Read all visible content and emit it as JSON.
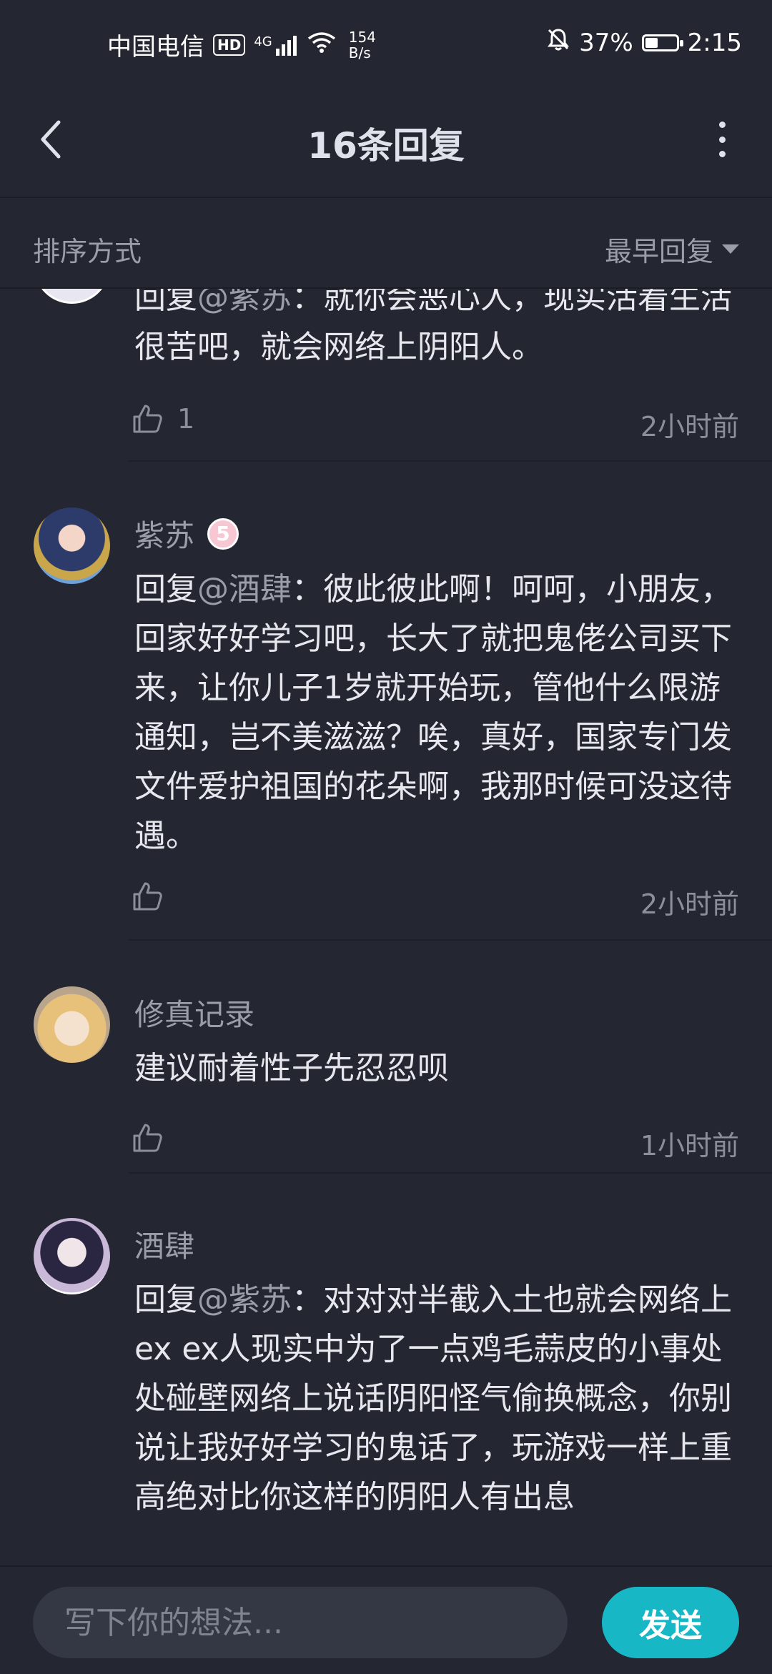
{
  "status_bar": {
    "carrier": "中国电信",
    "hd": "HD",
    "signal_type": "4G",
    "net_speed_value": "154",
    "net_speed_unit": "B/s",
    "battery_percent": "37%",
    "battery_level": 0.37,
    "time": "2:15"
  },
  "header": {
    "title": "16条回复",
    "back_icon": "chevron-left-icon",
    "more_icon": "more-vertical-icon"
  },
  "sort": {
    "label": "排序方式",
    "value": "最早回复"
  },
  "comments": [
    {
      "reply_prefix": "回复",
      "mention": "@紫苏",
      "content": "：就你会恶心人，现实活着生活很苦吧，就会网络上阴阳人。",
      "likes": "1",
      "time": "2小时前"
    },
    {
      "name": "紫苏",
      "level": "5",
      "reply_prefix": "回复",
      "mention": "@酒肆",
      "content": "：彼此彼此啊！呵呵，小朋友，回家好好学习吧，长大了就把鬼佬公司买下来，让你儿子1岁就开始玩，管他什么限游通知，岂不美滋滋？唉，真好，国家专门发文件爱护祖国的花朵啊，我那时候可没这待遇。",
      "likes": "",
      "time": "2小时前"
    },
    {
      "name": "修真记录",
      "content": "建议耐着性子先忍忍呗",
      "likes": "",
      "time": "1小时前"
    },
    {
      "name": "酒肆",
      "reply_prefix": "回复",
      "mention": "@紫苏",
      "content": "：对对对半截入土也就会网络上ex ex人现实中为了一点鸡毛蒜皮的小事处处碰壁网络上说话阴阳怪气偷换概念，你别说让我好好学习的鬼话了，玩游戏一样上重高绝对比你这样的阴阳人有出息"
    }
  ],
  "composer": {
    "placeholder": "写下你的想法...",
    "send_label": "发送"
  },
  "colors": {
    "background": "#242631",
    "accent": "#18b7c6",
    "muted_text": "#9a9ea9"
  }
}
